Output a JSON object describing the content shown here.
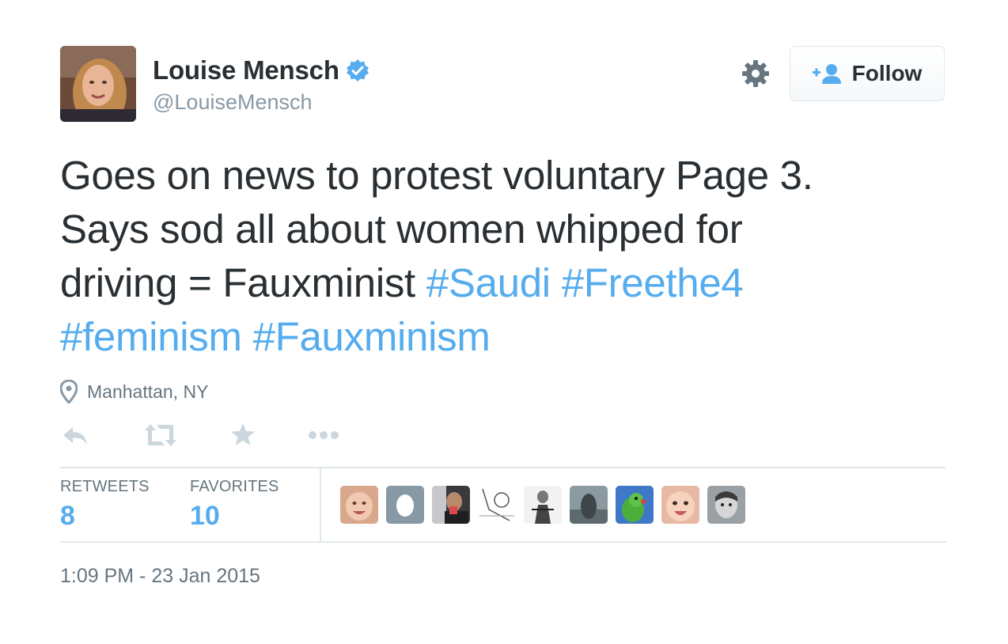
{
  "user": {
    "name": "Louise Mensch",
    "handle": "@LouiseMensch",
    "verified_icon": "verified-badge-icon"
  },
  "header": {
    "follow_label": "Follow",
    "gear_icon": "gear-icon",
    "follow_icon": "add-user-icon"
  },
  "tweet": {
    "text_lines": [
      "Goes on news to protest voluntary Page 3.",
      "Says sod all about women whipped for",
      "driving = Fauxminist "
    ],
    "hashtags": [
      "#Saudi",
      "#Freethe4",
      "#feminism",
      "#Fauxminism"
    ]
  },
  "location": {
    "icon": "map-pin-icon",
    "label": "Manhattan, NY"
  },
  "actions": [
    {
      "name": "reply",
      "icon": "reply-icon"
    },
    {
      "name": "retweet",
      "icon": "retweet-icon"
    },
    {
      "name": "favorite",
      "icon": "star-icon"
    },
    {
      "name": "more",
      "icon": "more-dots-icon"
    }
  ],
  "stats": {
    "retweets_label": "RETWEETS",
    "retweets_count": "8",
    "favorites_label": "FAVORITES",
    "favorites_count": "10"
  },
  "timestamp": "1:09 PM - 23 Jan 2015",
  "colors": {
    "accent": "#55acee",
    "text": "#292f33",
    "muted": "#8899a6",
    "action_icon": "#ccd6dd"
  }
}
